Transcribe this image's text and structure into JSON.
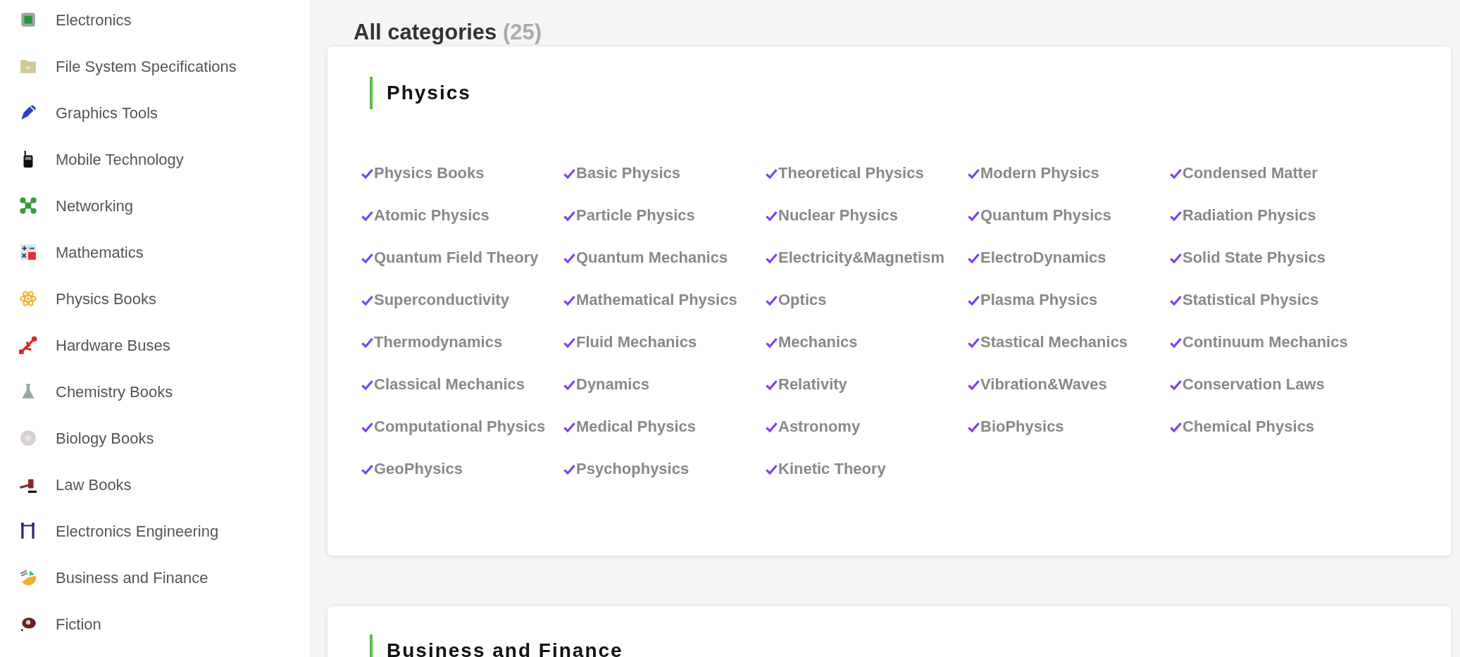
{
  "sidebar": {
    "items": [
      {
        "label": "Electronics"
      },
      {
        "label": "File System Specifications"
      },
      {
        "label": "Graphics Tools"
      },
      {
        "label": "Mobile Technology"
      },
      {
        "label": "Networking"
      },
      {
        "label": "Mathematics"
      },
      {
        "label": "Physics Books"
      },
      {
        "label": "Hardware Buses"
      },
      {
        "label": "Chemistry Books"
      },
      {
        "label": "Biology Books"
      },
      {
        "label": "Law Books"
      },
      {
        "label": "Electronics Engineering"
      },
      {
        "label": "Business and Finance"
      },
      {
        "label": "Fiction"
      }
    ]
  },
  "heading": {
    "title": "All categories",
    "count": "(25)"
  },
  "sections": [
    {
      "title": "Physics",
      "links": [
        "Physics Books",
        "Basic Physics",
        "Theoretical Physics",
        "Modern Physics",
        "Condensed Matter",
        "Atomic Physics",
        "Particle Physics",
        "Nuclear Physics",
        "Quantum Physics",
        "Radiation Physics",
        "Quantum Field Theory",
        "Quantum Mechanics",
        "Electricity&Magnetism",
        "ElectroDynamics",
        "Solid State Physics",
        "Superconductivity",
        "Mathematical Physics",
        "Optics",
        "Plasma Physics",
        "Statistical Physics",
        "Thermodynamics",
        "Fluid Mechanics",
        "Mechanics",
        "Stastical Mechanics",
        "Continuum Mechanics",
        "Classical Mechanics",
        "Dynamics",
        "Relativity",
        "Vibration&Waves",
        "Conservation Laws",
        "Computational Physics",
        "Medical Physics",
        "Astronomy",
        "BioPhysics",
        "Chemical Physics",
        "GeoPhysics",
        "Psychophysics",
        "Kinetic Theory"
      ]
    },
    {
      "title": "Business and Finance"
    }
  ]
}
